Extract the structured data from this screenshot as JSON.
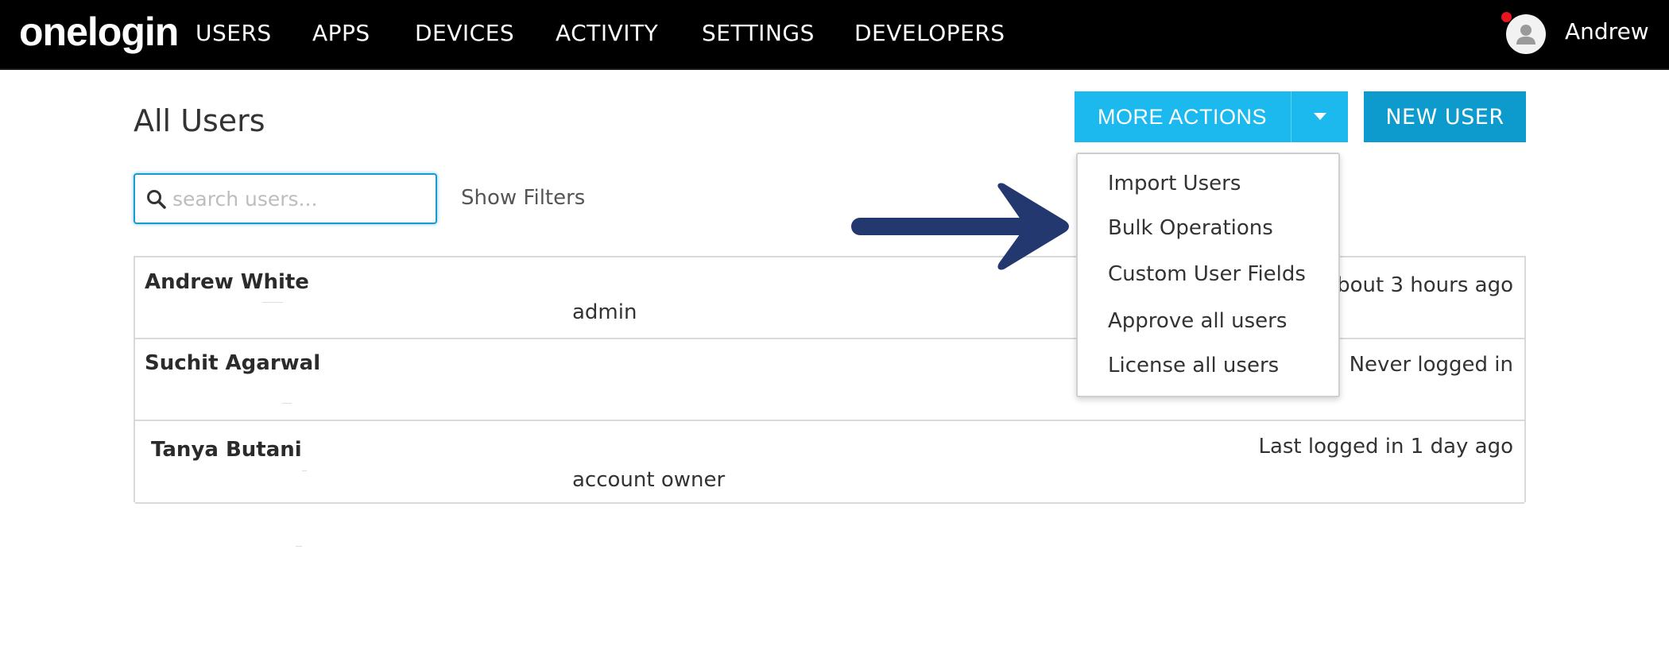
{
  "brand": {
    "logo_text": "onelogin"
  },
  "nav": {
    "items": [
      {
        "label": "USERS"
      },
      {
        "label": "APPS"
      },
      {
        "label": "DEVICES"
      },
      {
        "label": "ACTIVITY"
      },
      {
        "label": "SETTINGS"
      },
      {
        "label": "DEVELOPERS"
      }
    ],
    "user": {
      "name": "Andrew",
      "avatar_icon": "user-avatar-icon",
      "notification_color": "#e8141f"
    }
  },
  "page": {
    "title": "All Users"
  },
  "toolbar": {
    "more_actions_label": "MORE ACTIONS",
    "new_user_label": "NEW USER",
    "more_actions_color": "#1cb9ee",
    "new_user_color": "#0d9acd"
  },
  "search": {
    "placeholder": "search users...",
    "value": "",
    "icon": "search-icon"
  },
  "filters": {
    "show_filters_label": "Show Filters"
  },
  "users": [
    {
      "name": "Andrew White",
      "role": "admin",
      "status": "bout 3 hours ago"
    },
    {
      "name": "Suchit Agarwal",
      "role": "",
      "status": "Never logged in"
    },
    {
      "name": "Tanya Butani",
      "role": "account owner",
      "status": "Last logged in 1 day ago"
    }
  ],
  "more_actions_menu": {
    "items": [
      {
        "label": "Import Users"
      },
      {
        "label": "Bulk Operations"
      },
      {
        "label": "Custom User Fields"
      },
      {
        "label": "Approve all users"
      },
      {
        "label": "License all users"
      }
    ]
  },
  "annotation": {
    "arrow_color": "#22386f",
    "arrow_icon": "pointer-arrow-icon"
  }
}
